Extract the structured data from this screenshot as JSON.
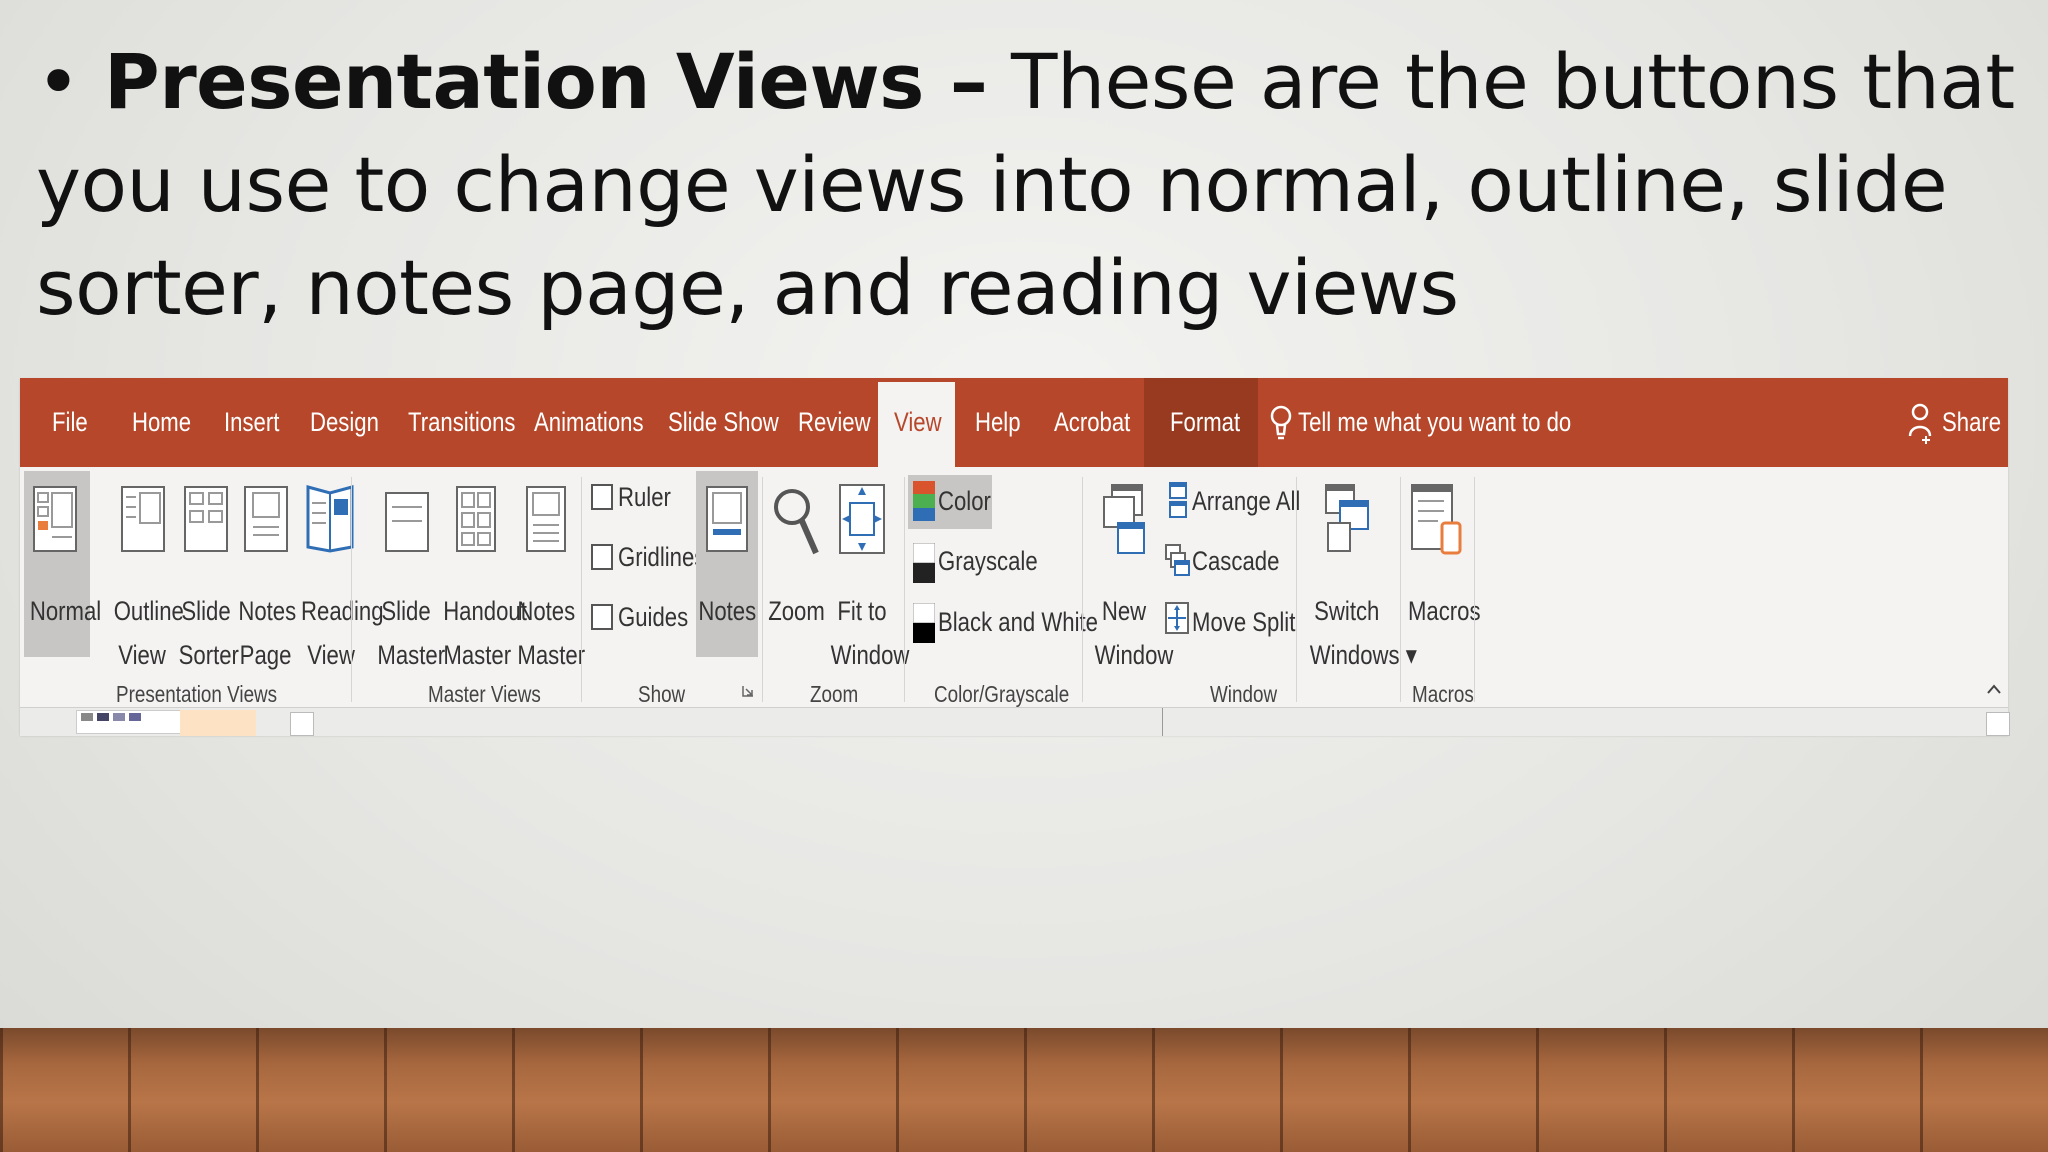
{
  "slide": {
    "bullet": "•",
    "bold_lead": "Presentation Views –",
    "body": "These are the buttons that you use to change views into normal, outline, slide sorter, notes page, and reading views"
  },
  "tabs": [
    "File",
    "Home",
    "Insert",
    "Design",
    "Transitions",
    "Animations",
    "Slide Show",
    "Review",
    "View",
    "Help",
    "Acrobat",
    "Format"
  ],
  "active_tab": "View",
  "tell_me": "Tell me what you want to do",
  "share": "Share",
  "groups": {
    "presentation_views": {
      "label": "Presentation Views",
      "normal": "Normal",
      "outline_1": "Outline",
      "outline_2": "View",
      "sorter_1": "Slide",
      "sorter_2": "Sorter",
      "notespage_1": "Notes",
      "notespage_2": "Page",
      "reading_1": "Reading",
      "reading_2": "View"
    },
    "master_views": {
      "label": "Master Views",
      "slide_1": "Slide",
      "slide_2": "Master",
      "handout_1": "Handout",
      "handout_2": "Master",
      "notes_1": "Notes",
      "notes_2": "Master"
    },
    "show": {
      "label": "Show",
      "ruler": "Ruler",
      "gridlines": "Gridlines",
      "guides": "Guides",
      "notes": "Notes"
    },
    "zoom": {
      "label": "Zoom",
      "zoom": "Zoom",
      "fit_1": "Fit to",
      "fit_2": "Window"
    },
    "color": {
      "label": "Color/Grayscale",
      "color": "Color",
      "grayscale": "Grayscale",
      "bw": "Black and White"
    },
    "window": {
      "label": "Window",
      "new_1": "New",
      "new_2": "Window",
      "arrange": "Arrange All",
      "cascade": "Cascade",
      "move_split": "Move Split",
      "switch_1": "Switch",
      "switch_2": "Windows ▾"
    },
    "macros": {
      "label": "Macros",
      "macros": "Macros"
    }
  },
  "colors": {
    "ribbon_tab_bar": "#b7472a",
    "format_tab": "#983a20",
    "ribbon_body": "#f4f3f2"
  }
}
